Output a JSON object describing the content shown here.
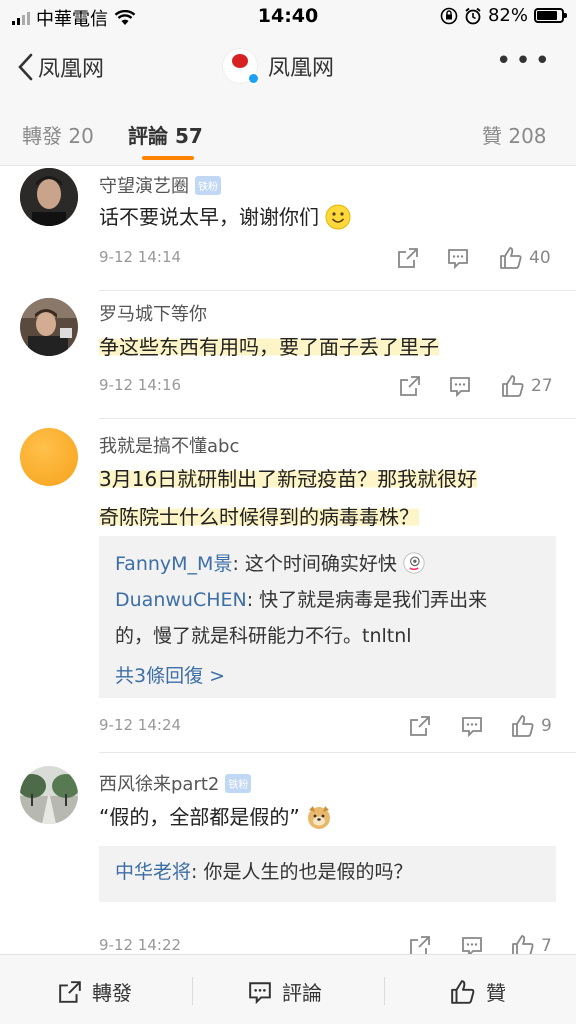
{
  "status_bar": {
    "carrier": "中華電信",
    "time": "14:40",
    "battery": "82%"
  },
  "nav": {
    "back_label": "凤凰网",
    "title": "凤凰网",
    "logo_text": "鳳凰網"
  },
  "tabs": [
    {
      "label": "轉發",
      "count": "20"
    },
    {
      "label": "評論",
      "count": "57"
    },
    {
      "label": "贊",
      "count": "208"
    }
  ],
  "comments": [
    {
      "user": "守望演艺圈",
      "badge": "铁粉",
      "text": "话不要说太早，谢谢你们",
      "time": "9-12 14:14",
      "likes": "40",
      "avatar_icon": "man-portrait"
    },
    {
      "user": "罗马城下等你",
      "text": "争这些东西有用吗，要了面子丢了里子",
      "time": "9-12 14:16",
      "likes": "27",
      "avatar_icon": "man-portrait-dark"
    },
    {
      "user": "我就是搞不懂abc",
      "text_line1": "3月16日就研制出了新冠疫苗？那我就很好",
      "text_line2": "奇陈院士什么时候得到的病毒毒株？",
      "time": "9-12 14:24",
      "likes": "9",
      "avatar_icon": "orange-circle",
      "replies": [
        {
          "user": "FannyM_M景",
          "text": "这个时间确实好快"
        },
        {
          "user": "DuanwuCHEN",
          "text_line1": "快了就是病毒是我们弄出来",
          "text_line2": "的，慢了就是科研能力不行。tnltnl"
        }
      ],
      "more_replies": "共3條回復 >"
    },
    {
      "user": "西风徐来part2",
      "badge": "铁粉",
      "text": "“假的，全部都是假的”",
      "time": "9-12 14:22",
      "likes": "7",
      "avatar_icon": "tree-road-photo",
      "replies": [
        {
          "user": "中华老将",
          "text": "你是人生的也是假的吗？"
        }
      ]
    }
  ],
  "bottom_bar": {
    "repost": "轉發",
    "comment": "評論",
    "like": "贊"
  },
  "colors": {
    "accent": "#ff8200",
    "link": "#3d6fa6",
    "highlight": "#fdf5c8"
  }
}
